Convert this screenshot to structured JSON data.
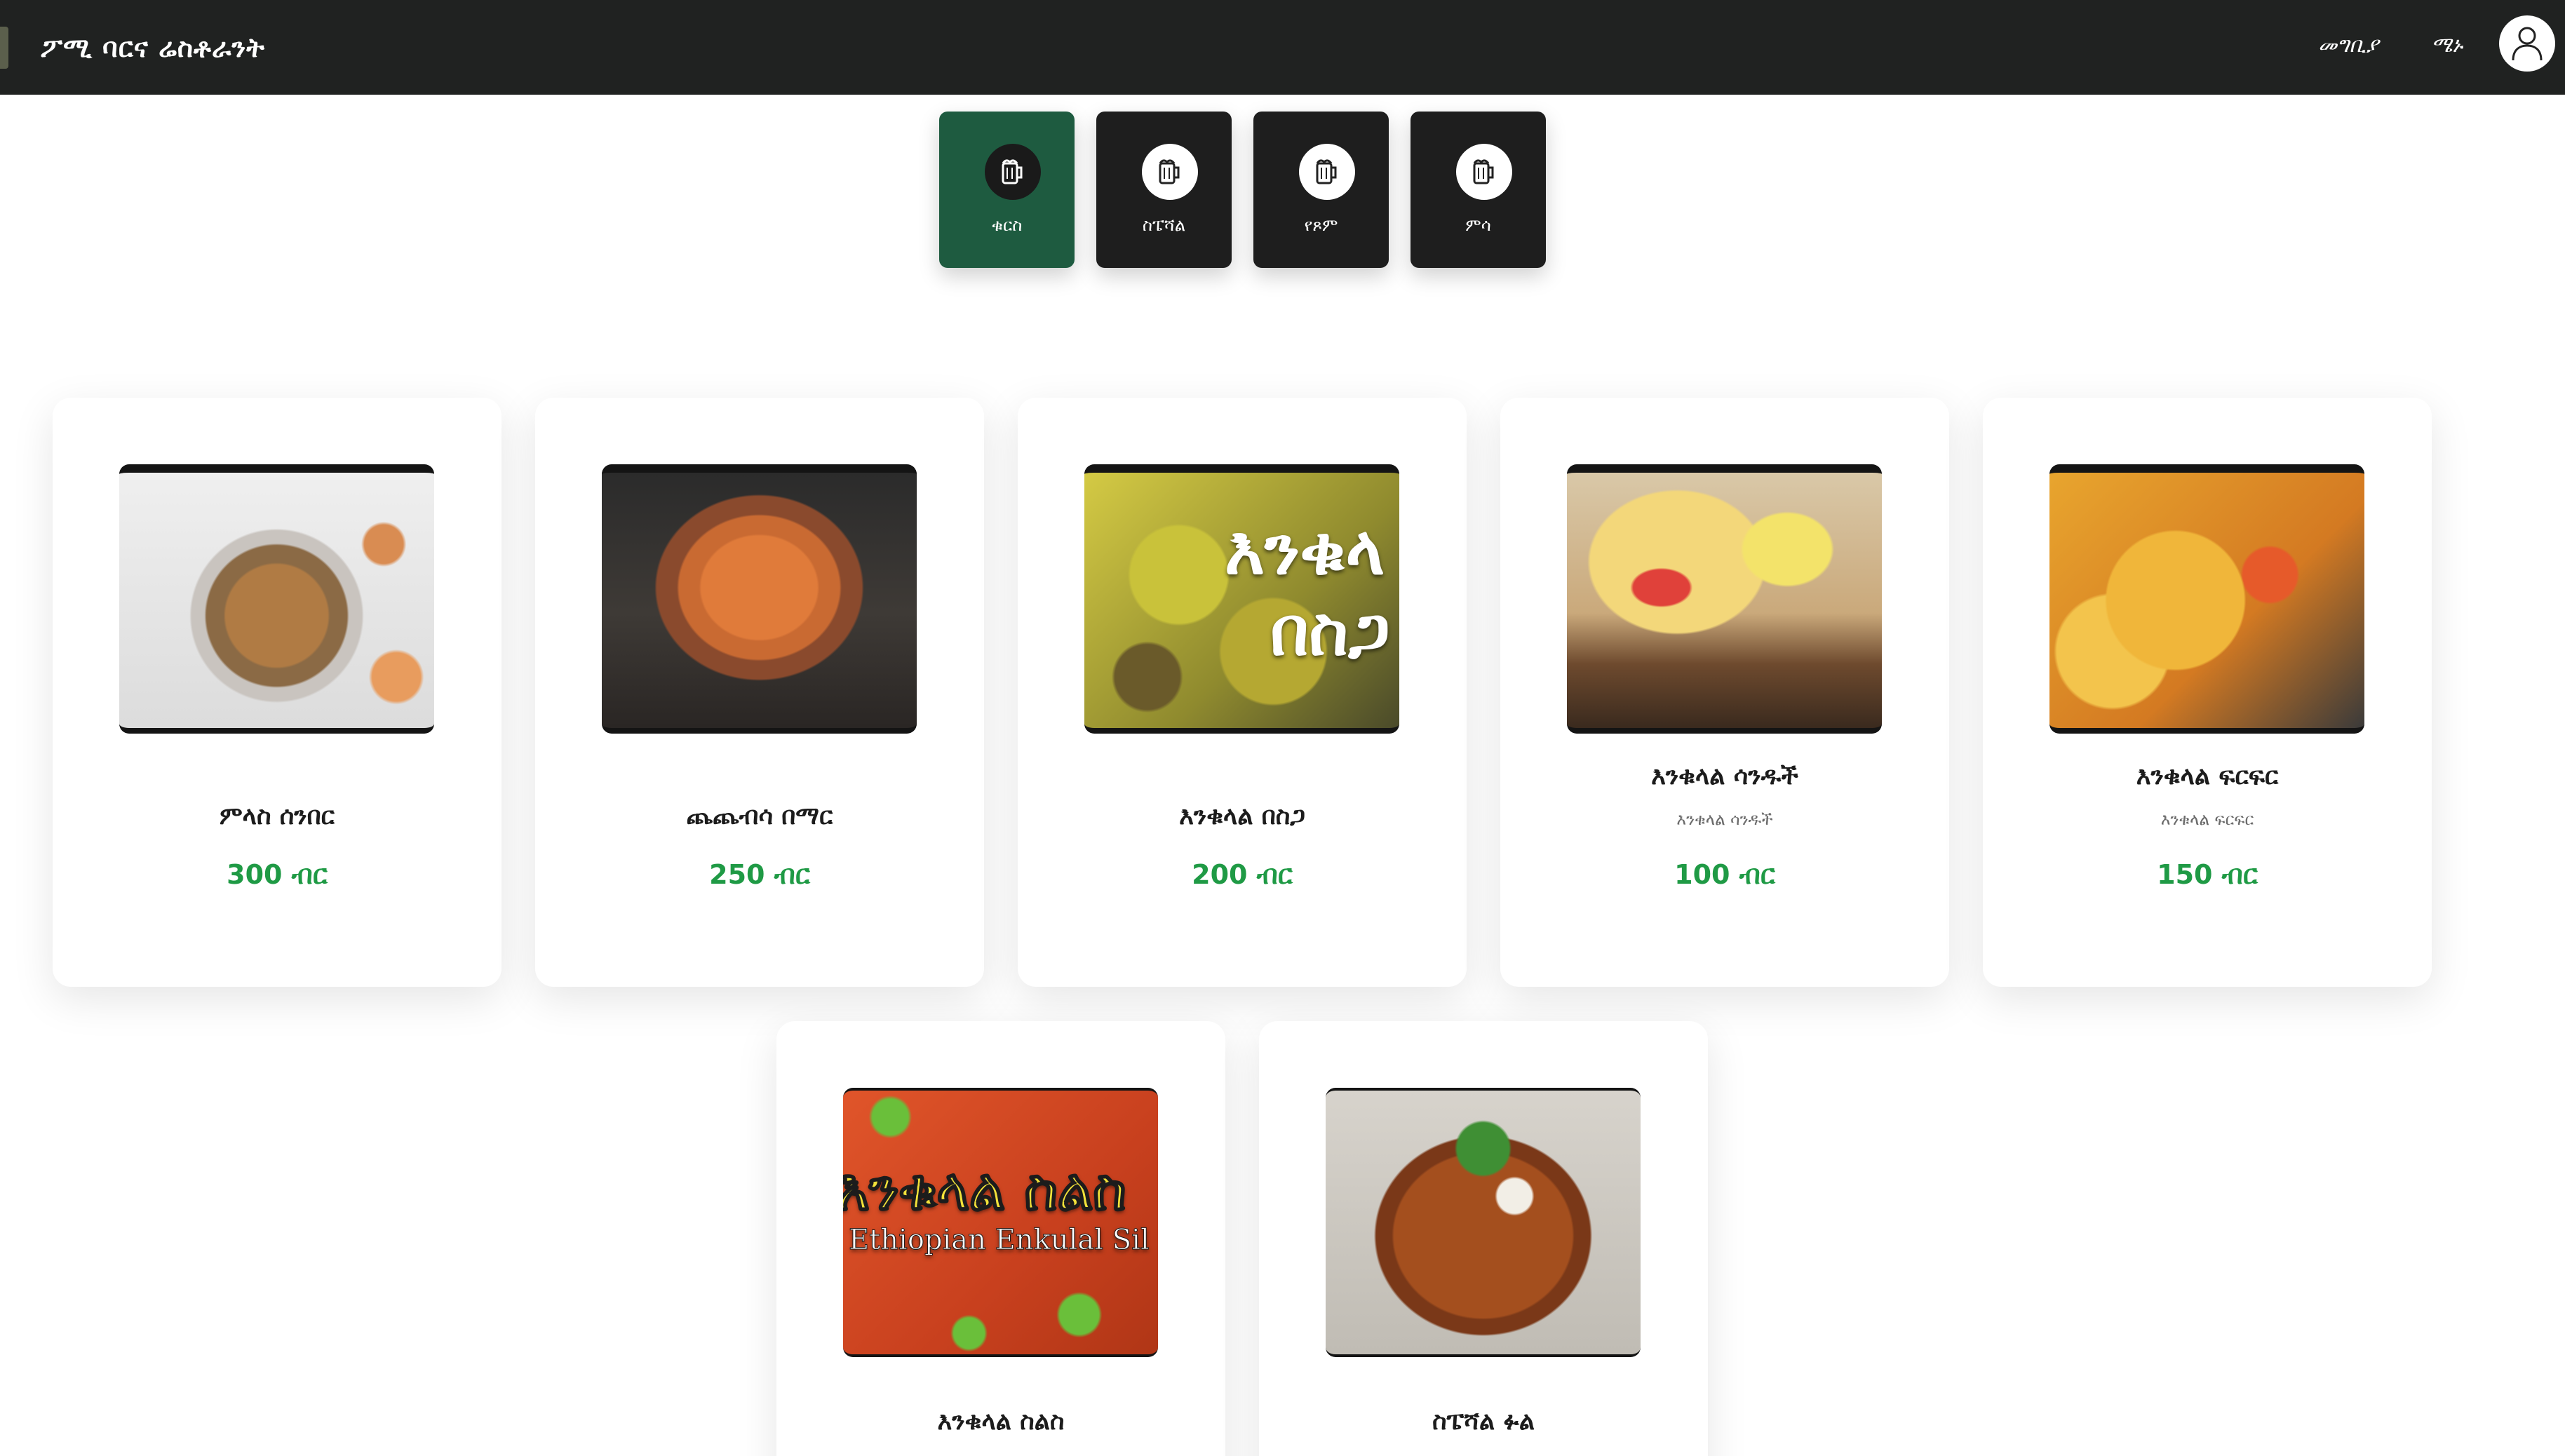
{
  "header": {
    "title": "ፖሚ ባርና ሬስቶራንት",
    "nav": {
      "home": "መግቢያ",
      "menu": "ሜኑ"
    },
    "icons": {
      "brand": "brand-logo-icon",
      "profile": "user-icon"
    }
  },
  "categories": [
    {
      "label": "ቁርስ",
      "icon": "beer-mug-icon",
      "active": true
    },
    {
      "label": "ስፔሻል",
      "icon": "beer-mug-icon",
      "active": false
    },
    {
      "label": "የጾም",
      "icon": "beer-mug-icon",
      "active": false
    },
    {
      "label": "ምሳ",
      "icon": "beer-mug-icon",
      "active": false
    }
  ],
  "products": [
    {
      "name": "ምላስ ሰንበር",
      "description": "",
      "price": "300 ብር",
      "image_text": []
    },
    {
      "name": "ጨጨብሳ በማር",
      "description": "",
      "price": "250 ብር",
      "image_text": []
    },
    {
      "name": "እንቁላል በስጋ",
      "description": "",
      "price": "200 ብር",
      "image_text": [
        "እንቁላ",
        "በስጋ"
      ]
    },
    {
      "name": "እንቁላል ሳንዱች",
      "description": "እንቁላል ሳንዱች",
      "price": "100 ብር",
      "image_text": []
    },
    {
      "name": "እንቁላል ፍርፍር",
      "description": "እንቁላል ፍርፍር",
      "price": "150 ብር",
      "image_text": []
    },
    {
      "name": "እንቁላል ስልስ",
      "description": "",
      "price": "",
      "image_text": [
        "እንቁላል ስልስ",
        "Ethiopian Enkulal Sil"
      ]
    },
    {
      "name": "ስፔሻል ፉል",
      "description": "",
      "price": "",
      "image_text": []
    }
  ],
  "colors": {
    "header_bg": "#202221",
    "active_tab": "#1e5b40",
    "tab_bg": "#1e1e1e",
    "price": "#1f9a45"
  }
}
